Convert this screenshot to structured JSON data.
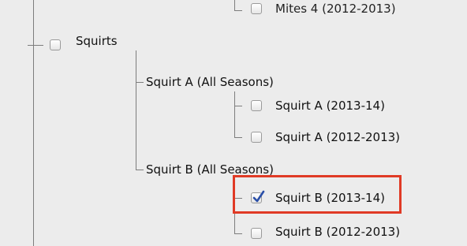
{
  "tree": {
    "mites4_label": "Mites 4 (2012-2013)",
    "squirts": {
      "label": "Squirts",
      "checked": false,
      "children": [
        {
          "label": "Squirt A (All Seasons)",
          "children": [
            {
              "label": "Squirt A (2013-14)",
              "checked": false
            },
            {
              "label": "Squirt A (2012-2013)",
              "checked": false
            }
          ]
        },
        {
          "label": "Squirt B (All Seasons)",
          "children": [
            {
              "label": "Squirt B (2013-14)",
              "checked": true
            },
            {
              "label": "Squirt B (2012-2013)",
              "checked": false
            }
          ]
        }
      ]
    }
  },
  "colors": {
    "highlight": "#e03a25",
    "check": "#2a4fa8"
  }
}
